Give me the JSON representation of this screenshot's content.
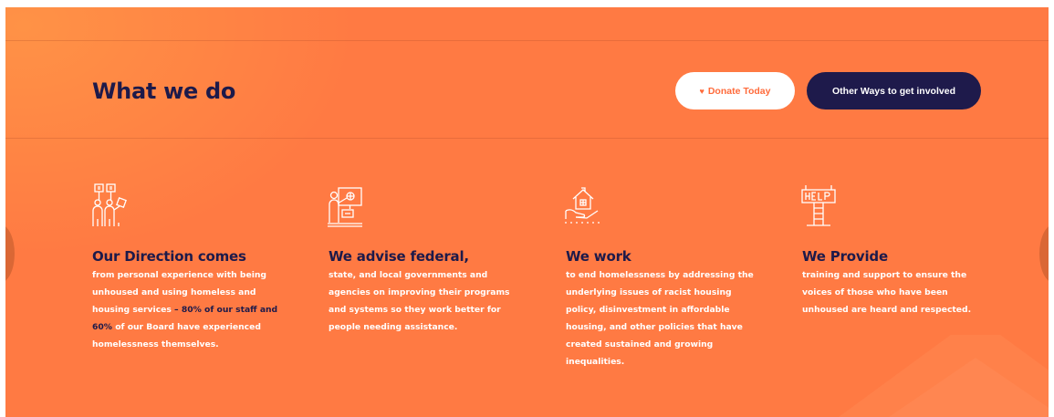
{
  "section": {
    "title": "What we do",
    "donate_label": "Donate Today",
    "other_label": "Other Ways to get involved"
  },
  "columns": [
    {
      "icon": "people-protest-signs-icon",
      "title": "Our Direction comes",
      "text_before": "from personal experience with being unhoused and using homeless and housing services",
      "text_bold": " – 80% of our staff and 60%",
      "text_after": " of our Board have experienced homelessness themselves."
    },
    {
      "icon": "presenter-board-icon",
      "title": "We advise federal,",
      "text": "state, and local governments and agencies on improving their programs and systems so they work better for people needing assistance."
    },
    {
      "icon": "hand-holding-house-icon",
      "title": "We work",
      "text": "to end homelessness by addressing the underlying issues of  racist housing policy, disinvestment in affordable housing, and other policies that have created sustained and growing inequalities."
    },
    {
      "icon": "help-sign-icon",
      "title": "We Provide",
      "text": "training and support to ensure the voices of those who have been unhoused are heard and respected."
    }
  ],
  "colors": {
    "background": "#ff7a43",
    "navy": "#1d1a4a",
    "donate_text": "#ff6b3b",
    "white": "#ffffff"
  }
}
